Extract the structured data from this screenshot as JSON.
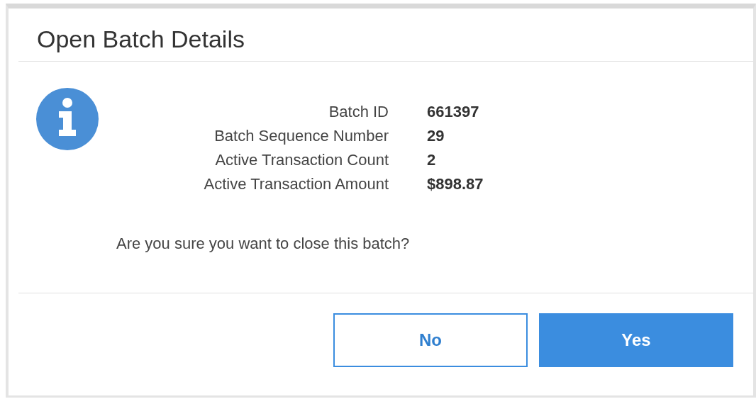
{
  "dialog": {
    "title": "Open Batch Details",
    "details": [
      {
        "label": "Batch ID",
        "value": "661397"
      },
      {
        "label": "Batch Sequence Number",
        "value": "29"
      },
      {
        "label": "Active Transaction Count",
        "value": "2"
      },
      {
        "label": "Active Transaction Amount",
        "value": "$898.87"
      }
    ],
    "message": "Are you sure you want to close this batch?",
    "buttons": [
      {
        "label": "No",
        "kind": "secondary"
      },
      {
        "label": "Yes",
        "kind": "primary"
      }
    ]
  }
}
